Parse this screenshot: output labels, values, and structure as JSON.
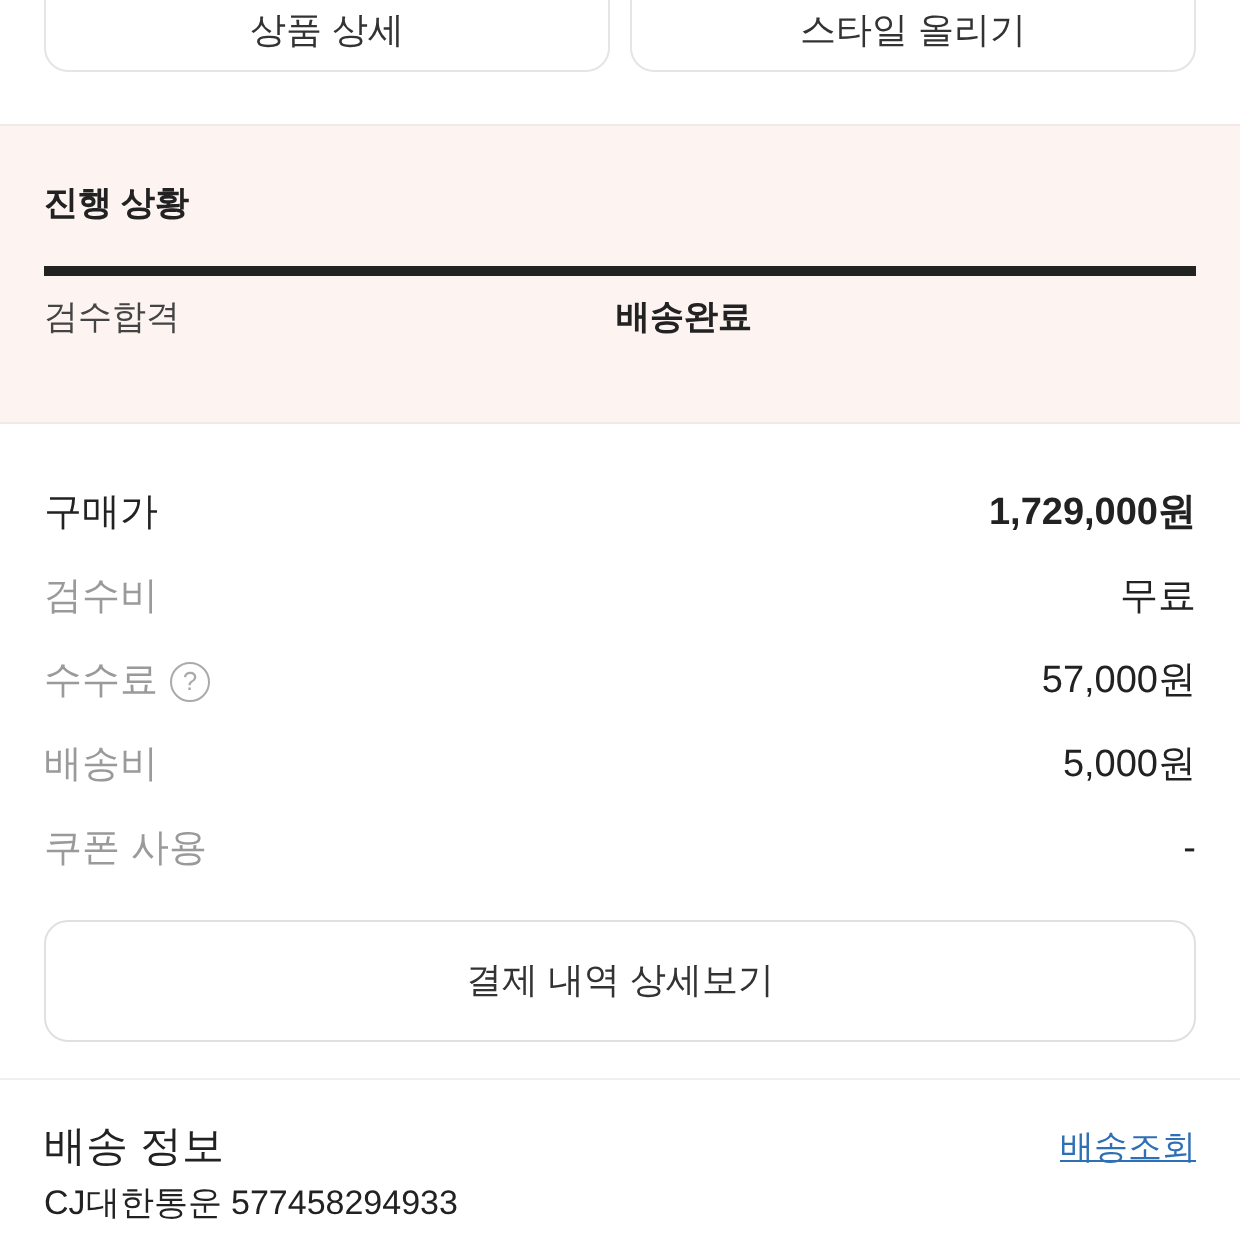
{
  "top_buttons": [
    "상품 상세",
    "스타일 올리기"
  ],
  "progress": {
    "title": "진행 상황",
    "level": 1,
    "steps": [
      {
        "label": "검수합격",
        "current": false
      },
      {
        "label": "배송완료",
        "current": true
      }
    ]
  },
  "price_rows": [
    {
      "label": "구매가",
      "value": "1,729,000원",
      "emphasis": true
    },
    {
      "label": "검수비",
      "value": "무료",
      "emphasis": false
    },
    {
      "label": "수수료",
      "value": "57,000원",
      "emphasis": false,
      "help_mark": "?"
    },
    {
      "label": "배송비",
      "value": "5,000원",
      "emphasis": false
    },
    {
      "label": "쿠폰 사용",
      "value": "-",
      "emphasis": false
    }
  ],
  "detail_button": "결제 내역 상세보기",
  "shipping": {
    "title": "배송 정보",
    "track_link": "배송조회",
    "carrier_line": "CJ대한통운 577458294933"
  }
}
